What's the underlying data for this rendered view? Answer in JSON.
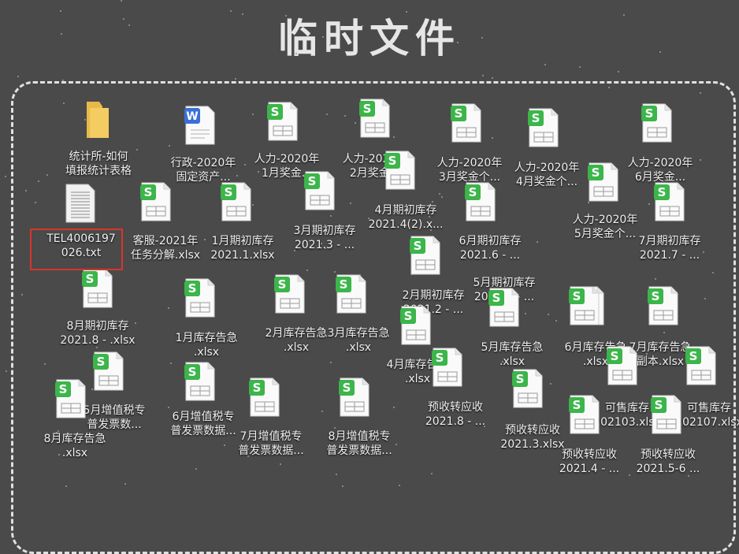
{
  "title": "临时文件",
  "files": [
    {
      "label": "统计所-如何\n填报统计表格",
      "type": "folder"
    },
    {
      "label": "行政-2020年\n固定资产...",
      "type": "word"
    },
    {
      "label": "人力-2020年\n1月奖金...",
      "type": "sheet"
    },
    {
      "label": "人力-2020年\n2月奖金...",
      "type": "sheet"
    },
    {
      "label": "人力-2020年\n3月奖金个...",
      "type": "sheet"
    },
    {
      "label": "人力-2020年\n4月奖金个...",
      "type": "sheet"
    },
    {
      "label": "人力-2020年\n6月奖金...",
      "type": "sheet"
    },
    {
      "label": "4月期初库存\n2021.4(2).x...",
      "type": "sheet"
    },
    {
      "label": "TEL4006197\n026.txt",
      "type": "text"
    },
    {
      "label": "客服-2021年\n任务分解.xlsx",
      "type": "sheet"
    },
    {
      "label": "1月期初库存\n2021.1.xlsx",
      "type": "sheet"
    },
    {
      "label": "3月期初库存\n2021.3 - ...",
      "type": "sheet"
    },
    {
      "label": "6月期初库存\n2021.6 - ...",
      "type": "sheet"
    },
    {
      "label": "人力-2020年\n5月奖金个...",
      "type": "sheet"
    },
    {
      "label": "7月期初库存\n2021.7 - ...",
      "type": "sheet"
    },
    {
      "label": "2月期初库存\n2021.2 - ...",
      "type": "sheet"
    },
    {
      "label": "5月期初库存\n2021.5 - ...",
      "type": "sheet"
    },
    {
      "label": "8月期初库存\n2021.8 - .xlsx",
      "type": "sheet"
    },
    {
      "label": "1月库存告急\n.xlsx",
      "type": "sheet"
    },
    {
      "label": "2月库存告急\n.xlsx",
      "type": "sheet"
    },
    {
      "label": "3月库存告急\n.xlsx",
      "type": "sheet"
    },
    {
      "label": "4月库存告急\n.xlsx",
      "type": "sheet"
    },
    {
      "label": "5月库存告急\n.xlsx",
      "type": "sheet"
    },
    {
      "label": "6月库存告急\n.xlsx",
      "type": "sheet"
    },
    {
      "label": "7月库存告急\n副本.xlsx",
      "type": "sheet"
    },
    {
      "label": "5月增值税专\n普发票数...",
      "type": "sheet"
    },
    {
      "label": "8月库存告急\n.xlsx",
      "type": "sheet"
    },
    {
      "label": "6月增值税专\n普发票数据...",
      "type": "sheet"
    },
    {
      "label": "7月增值税专\n普发票数据...",
      "type": "sheet"
    },
    {
      "label": "8月增值税专\n普发票数据...",
      "type": "sheet"
    },
    {
      "label": "预收转应收\n2021.8 - ...",
      "type": "sheet"
    },
    {
      "label": "预收转应收\n2021.3.xlsx",
      "type": "sheet"
    },
    {
      "label": "可售库存\n202103.xlsx",
      "type": "sheet"
    },
    {
      "label": "可售库存\n202107.xlsx",
      "type": "sheet"
    },
    {
      "label": "预收转应收\n2021.4 - ...",
      "type": "sheet"
    },
    {
      "label": "预收转应收\n2021.5-6 ...",
      "type": "sheet"
    }
  ],
  "colors": {
    "background": "#4a4a4a",
    "sheet_badge": "#3cb54a",
    "word_badge": "#3b6fd8",
    "folder": "#e8b94a",
    "highlight": "#d9342b"
  }
}
